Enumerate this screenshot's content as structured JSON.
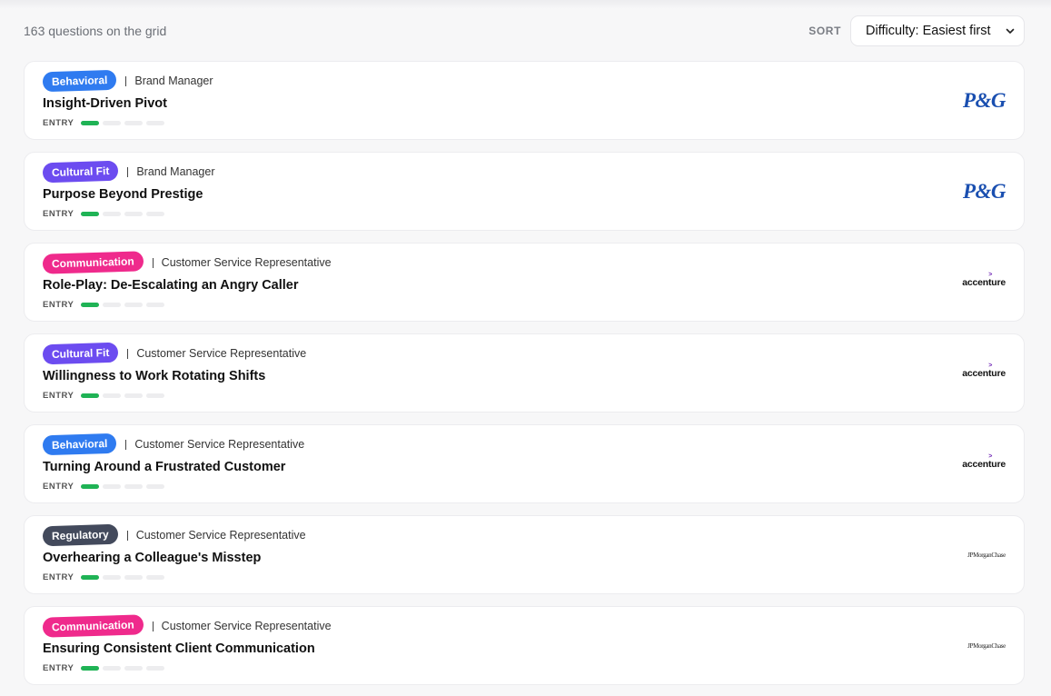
{
  "header": {
    "count_text": "163 questions on the grid",
    "sort_label": "SORT",
    "sort_value": "Difficulty: Easiest first"
  },
  "colors": {
    "behavioral": "#2f7bf0",
    "cultural_fit": "#6c4cf0",
    "communication": "#ef2a8c",
    "regulatory": "#434a5c",
    "difficulty_on": "#1fb355"
  },
  "questions": [
    {
      "tag": "Behavioral",
      "role": "Brand Manager",
      "title": "Insight-Driven Pivot",
      "difficulty": "ENTRY",
      "level": 1,
      "logo_text": "P&G"
    },
    {
      "tag": "Cultural Fit",
      "role": "Brand Manager",
      "title": "Purpose Beyond Prestige",
      "difficulty": "ENTRY",
      "level": 1,
      "logo_text": "P&G"
    },
    {
      "tag": "Communication",
      "role": "Customer Service Representative",
      "title": "Role-Play: De-Escalating an Angry Caller",
      "difficulty": "ENTRY",
      "level": 1,
      "logo_text": "accenture"
    },
    {
      "tag": "Cultural Fit",
      "role": "Customer Service Representative",
      "title": "Willingness to Work Rotating Shifts",
      "difficulty": "ENTRY",
      "level": 1,
      "logo_text": "accenture"
    },
    {
      "tag": "Behavioral",
      "role": "Customer Service Representative",
      "title": "Turning Around a Frustrated Customer",
      "difficulty": "ENTRY",
      "level": 1,
      "logo_text": "accenture"
    },
    {
      "tag": "Regulatory",
      "role": "Customer Service Representative",
      "title": "Overhearing a Colleague's Misstep",
      "difficulty": "ENTRY",
      "level": 1,
      "logo_text": "JPMorganChase"
    },
    {
      "tag": "Communication",
      "role": "Customer Service Representative",
      "title": "Ensuring Consistent Client Communication",
      "difficulty": "ENTRY",
      "level": 1,
      "logo_text": "JPMorganChase"
    }
  ]
}
